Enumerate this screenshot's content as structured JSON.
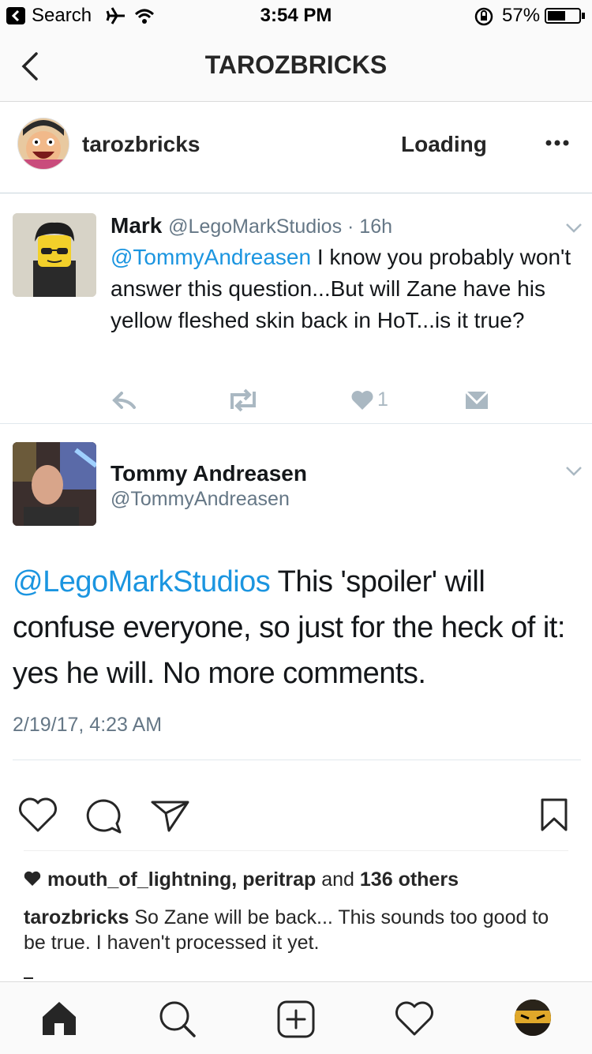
{
  "status_bar": {
    "back_app": "Search",
    "time": "3:54 PM",
    "battery": "57%",
    "battery_level": 0.57
  },
  "nav": {
    "title": "TAROZBRICKS"
  },
  "post": {
    "username": "tarozbricks",
    "follow_state": "Loading"
  },
  "tweet_1": {
    "name": "Mark",
    "handle_time": "@LegoMarkStudios · 16h",
    "mention": "@TommyAndreasen",
    "body": " I know you probably won't answer this question...But will Zane have his yellow fleshed skin back in HoT...is it true?",
    "like_count": "1"
  },
  "tweet_2": {
    "name": "Tommy Andreasen",
    "handle": "@TommyAndreasen",
    "mention": "@LegoMarkStudios",
    "body": " This 'spoiler' will confuse everyone, so just for the heck of it: yes he will. No more comments.",
    "timestamp": "2/19/17, 4:23 AM"
  },
  "likes": {
    "user1": "mouth_of_lightning",
    "sep": ", ",
    "user2": "peritrap",
    "and": " and ",
    "others": "136 others"
  },
  "caption": {
    "user": "tarozbricks",
    "text": " So Zane will be back... This sounds too good to be true. I haven't processed it yet."
  },
  "colors": {
    "twitter_blue": "#1b95e0",
    "twitter_grey": "#657786",
    "ig_text": "#262626"
  }
}
